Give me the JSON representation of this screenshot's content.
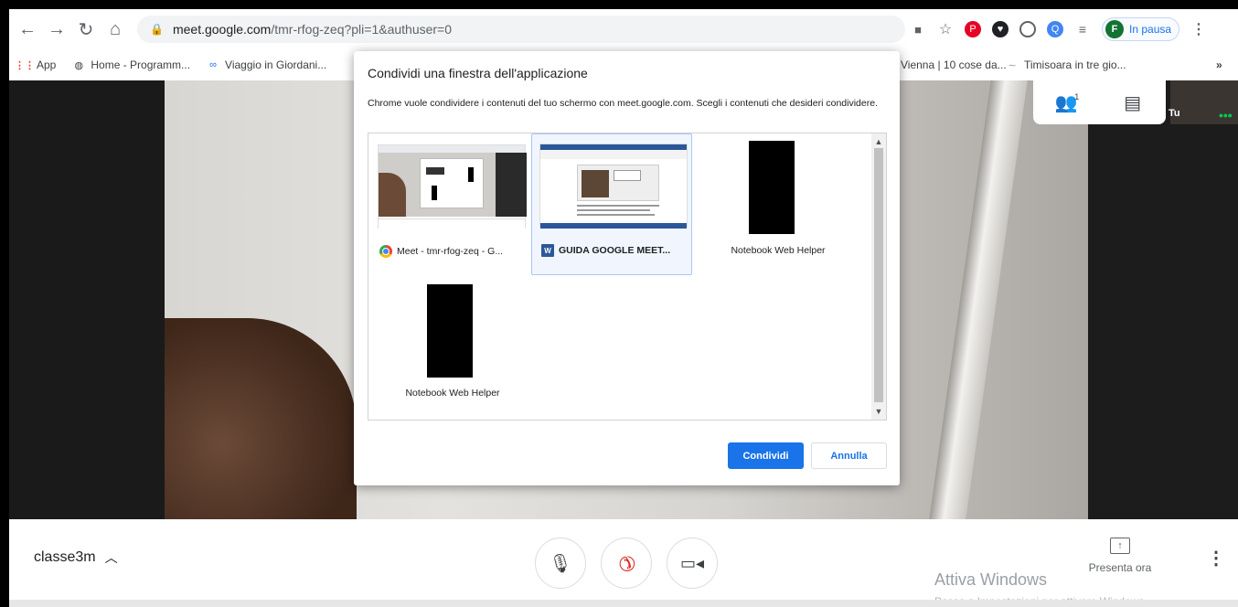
{
  "browser": {
    "url_host": "meet.google.com",
    "url_path": "/tmr-rfog-zeq?pli=1&authuser=0",
    "profile_initial": "F",
    "profile_status": "In pausa",
    "bookmarks": [
      {
        "label": "App"
      },
      {
        "label": "Home - Programm..."
      },
      {
        "label": "Viaggio in Giordani..."
      },
      {
        "label": "Vienna | 10 cose da..."
      },
      {
        "label": "Timisoara in tre gio..."
      }
    ],
    "more_bookmarks": "»"
  },
  "call": {
    "self_label": "Tu",
    "participants_count": "1"
  },
  "dialog": {
    "title": "Condividi una finestra dell'applicazione",
    "description": "Chrome vuole condividere i contenuti del tuo schermo con meet.google.com. Scegli i contenuti che desideri condividere.",
    "windows": [
      {
        "label": "Meet - tmr-rfog-zeq - G...",
        "icon": "chrome-icon",
        "selected": false
      },
      {
        "label": "GUIDA GOOGLE MEET...",
        "icon": "word-icon",
        "selected": true
      },
      {
        "label": "Notebook Web Helper",
        "icon": "",
        "selected": false
      },
      {
        "label": "Notebook Web Helper",
        "icon": "",
        "selected": false
      }
    ],
    "share_label": "Condividi",
    "cancel_label": "Annulla"
  },
  "bottom": {
    "meeting_name": "classe3m",
    "present_label": "Presenta ora"
  },
  "watermark": {
    "title": "Attiva Windows",
    "subtitle": "Passa a Impostazioni per attivare Windows."
  },
  "colors": {
    "accent": "#1a73e8",
    "hangup": "#d93025"
  }
}
